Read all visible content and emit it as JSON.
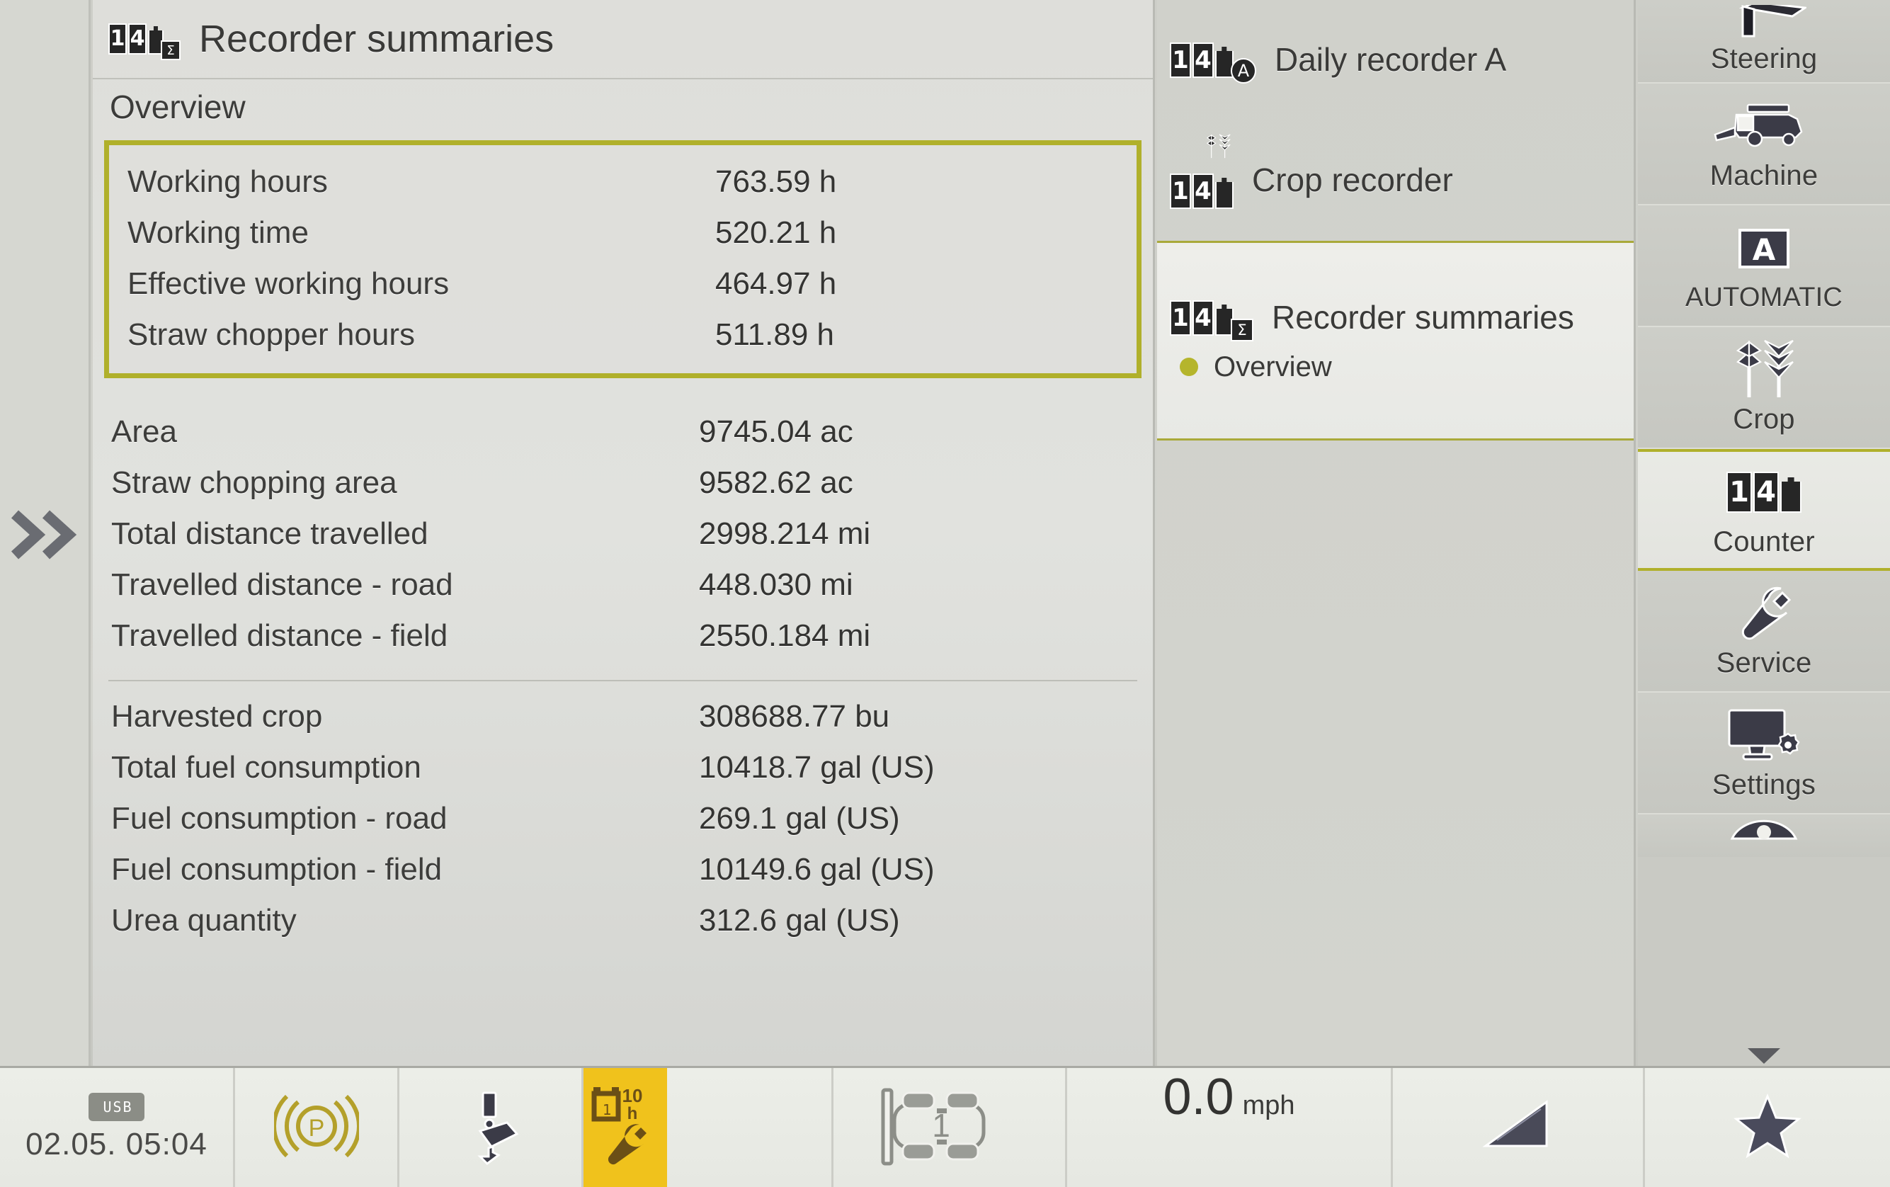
{
  "panel": {
    "icon": "counter-sum-icon",
    "title": "Recorder summaries",
    "subtitle": "Overview"
  },
  "groups": [
    {
      "id": "highlighted",
      "highlighted": true,
      "rows": [
        {
          "label": "Working hours",
          "value": "763.59 h"
        },
        {
          "label": "Working time",
          "value": "520.21 h"
        },
        {
          "label": "Effective working hours",
          "value": "464.97 h"
        },
        {
          "label": "Straw chopper hours",
          "value": "511.89 h"
        }
      ]
    },
    {
      "id": "area-distance",
      "highlighted": false,
      "rows": [
        {
          "label": "Area",
          "value": "9745.04 ac"
        },
        {
          "label": "Straw chopping area",
          "value": "9582.62 ac"
        },
        {
          "label": "Total distance travelled",
          "value": "2998.214 mi"
        },
        {
          "label": "Travelled distance - road",
          "value": "448.030 mi"
        },
        {
          "label": "Travelled distance - field",
          "value": "2550.184 mi"
        }
      ]
    },
    {
      "id": "yield-fuel",
      "highlighted": false,
      "rows": [
        {
          "label": "Harvested crop",
          "value": "308688.77 bu"
        },
        {
          "label": "Total fuel consumption",
          "value": "10418.7 gal (US)"
        },
        {
          "label": "Fuel consumption - road",
          "value": "269.1 gal (US)"
        },
        {
          "label": "Fuel consumption - field",
          "value": "10149.6 gal (US)"
        },
        {
          "label": "Urea quantity",
          "value": "312.6 gal (US)"
        }
      ]
    }
  ],
  "nav": {
    "items": [
      {
        "label": "Daily recorder A",
        "icon": "counter-a-icon",
        "selected": false
      },
      {
        "label": "Crop recorder",
        "icon": "counter-crop-icon",
        "selected": false
      },
      {
        "label": "Recorder summaries",
        "icon": "counter-sum-icon",
        "selected": true
      }
    ],
    "sub_item": {
      "label": "Overview",
      "bullet_color": "#b5b52c",
      "selected": true
    }
  },
  "sidebar": {
    "items": [
      {
        "label": "Steering",
        "icon": "steering-icon",
        "selected": false
      },
      {
        "label": "Machine",
        "icon": "combine-harvester-icon",
        "selected": false
      },
      {
        "label": "AUTOMATIC",
        "icon": "automatic-a-icon",
        "selected": false
      },
      {
        "label": "Crop",
        "icon": "wheat-ears-icon",
        "selected": false
      },
      {
        "label": "Counter",
        "icon": "counter-icon",
        "selected": true
      },
      {
        "label": "Service",
        "icon": "wrench-icon",
        "selected": false
      },
      {
        "label": "Settings",
        "icon": "monitor-gear-icon",
        "selected": false
      }
    ]
  },
  "status_bar": {
    "usb_label": "USB",
    "datetime": "02.05.   05:04",
    "park_brake_letter": "P",
    "service_hours": "10",
    "service_hours_unit": "h",
    "gear_number": "1",
    "speed_value": "0.0",
    "speed_unit": "mph"
  },
  "colors": {
    "highlight": "#b0b02b",
    "bullet": "#b5b52c",
    "service_badge": "#f0c21c",
    "panel_bg": "#dededa",
    "rail_bg": "#c9cac4"
  }
}
